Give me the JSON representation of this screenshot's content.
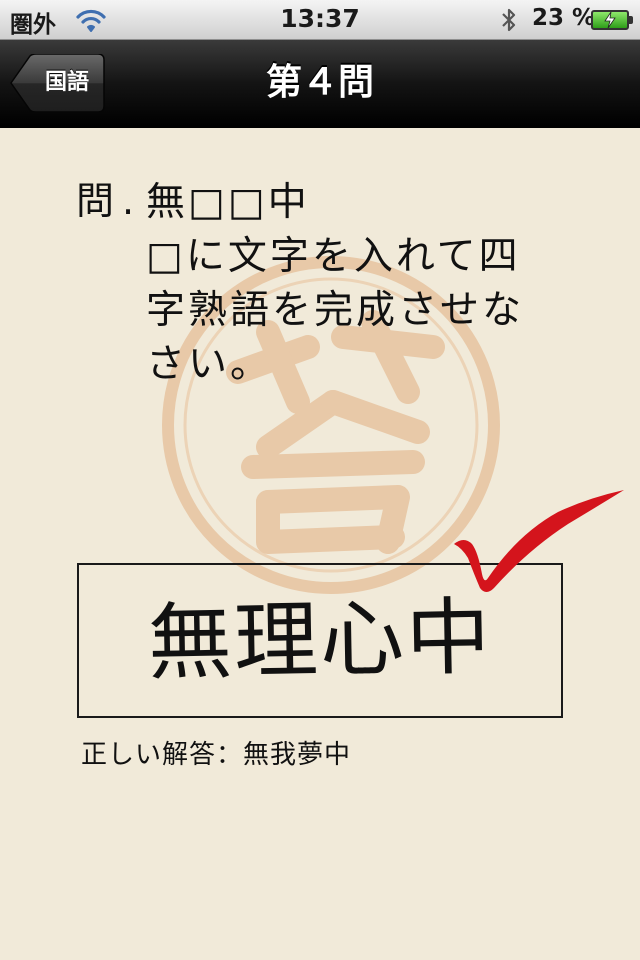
{
  "status_bar": {
    "carrier": "圏外",
    "time": "13:37",
    "battery_percent": "23 %"
  },
  "nav": {
    "back_label": "国語",
    "title": "第４問"
  },
  "question": {
    "marker": "問",
    "dot": ".",
    "lines": [
      "無□□中",
      "□に文字を入れて四",
      "字熟語を完成させな",
      "さい。"
    ]
  },
  "answer": {
    "user_answer": "無理心中",
    "correct_answer": "正しい解答：無我夢中"
  },
  "colors": {
    "background": "#f1ead9",
    "watermark": "#e8c9a8",
    "check_mark": "#d4141c",
    "nav_bar": "#141414"
  }
}
